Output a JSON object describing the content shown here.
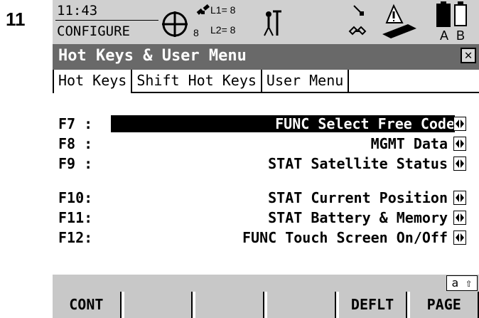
{
  "step_number": "11",
  "status": {
    "time": "11:43",
    "mode": "CONFIGURE",
    "sat_count": "8",
    "l1": "L1= 8",
    "l2": "L2= 8",
    "battery_a": "A",
    "battery_b": "B"
  },
  "title": "Hot Keys & User Menu",
  "tabs": [
    "Hot Keys",
    "Shift Hot Keys",
    "User Menu"
  ],
  "rows": [
    {
      "key": "F7 :",
      "value": "FUNC Select Free Code"
    },
    {
      "key": "F8 :",
      "value": "MGMT Data"
    },
    {
      "key": "F9 :",
      "value": "STAT Satellite Status"
    },
    {
      "key": "F10:",
      "value": "STAT Current Position"
    },
    {
      "key": "F11:",
      "value": "STAT Battery & Memory"
    },
    {
      "key": "F12:",
      "value": "FUNC Touch Screen On/Off"
    }
  ],
  "input_mode": "a ⇧",
  "softkeys": [
    "CONT",
    "",
    "",
    "",
    "DEFLT",
    "PAGE"
  ]
}
